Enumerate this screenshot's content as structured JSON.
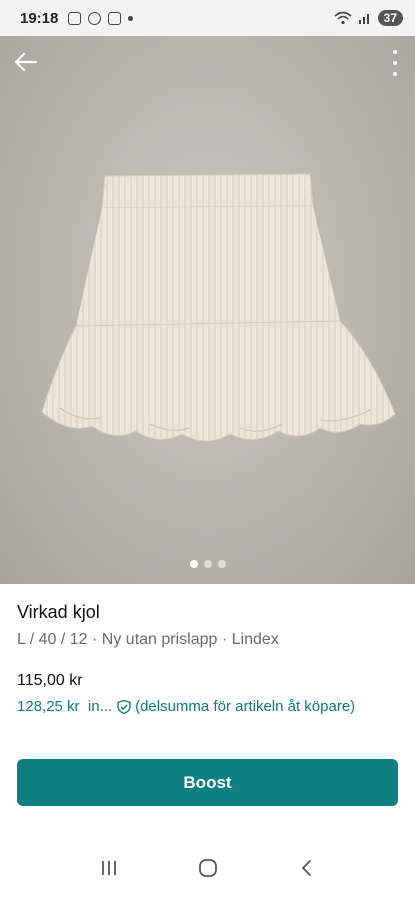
{
  "status_bar": {
    "time": "19:18",
    "battery": "37"
  },
  "listing": {
    "title": "Virkad kjol",
    "subtitle": "L / 40 / 12 · Ny utan prislapp · Lindex",
    "price": "115,00 kr",
    "price_incl_amount": "128,25 kr",
    "price_incl_truncated": "in...",
    "price_incl_note": "(delsumma för artikeln åt köpare)",
    "photo_count": 3,
    "photo_active_index": 0
  },
  "actions": {
    "boost_label": "Boost"
  },
  "colors": {
    "accent": "#0d7f82",
    "link": "#0b7c80",
    "photo_background": "#bdb8b1",
    "skirt": "#ede6d8"
  },
  "icons": {
    "back": "arrow-left-icon",
    "more": "more-vertical-icon",
    "shield": "shield-check-icon",
    "nav_recents": "recents-icon",
    "nav_home": "home-icon",
    "nav_back": "back-chevron-icon"
  }
}
